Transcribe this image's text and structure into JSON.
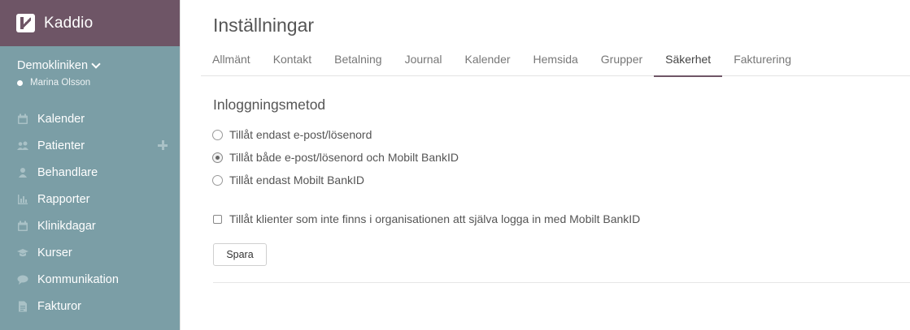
{
  "app": {
    "name": "Kaddio"
  },
  "clinic": {
    "name": "Demokliniken",
    "user": "Marina Olsson"
  },
  "sidebar": {
    "items": [
      {
        "label": "Kalender",
        "icon": "calendar-icon"
      },
      {
        "label": "Patienter",
        "icon": "users-icon",
        "has_add": true
      },
      {
        "label": "Behandlare",
        "icon": "user-icon"
      },
      {
        "label": "Rapporter",
        "icon": "bar-chart-icon"
      },
      {
        "label": "Klinikdagar",
        "icon": "calendar-icon"
      },
      {
        "label": "Kurser",
        "icon": "graduation-cap-icon"
      },
      {
        "label": "Kommunikation",
        "icon": "chat-bubble-icon"
      },
      {
        "label": "Fakturor",
        "icon": "document-icon"
      }
    ]
  },
  "page": {
    "title": "Inställningar"
  },
  "tabs": [
    {
      "label": "Allmänt"
    },
    {
      "label": "Kontakt"
    },
    {
      "label": "Betalning"
    },
    {
      "label": "Journal"
    },
    {
      "label": "Kalender"
    },
    {
      "label": "Hemsida"
    },
    {
      "label": "Grupper"
    },
    {
      "label": "Säkerhet",
      "active": true
    },
    {
      "label": "Fakturering"
    }
  ],
  "security": {
    "section_title": "Inloggningsmetod",
    "options": [
      {
        "label": "Tillåt endast e-post/lösenord",
        "checked": false
      },
      {
        "label": "Tillåt både e-post/lösenord och Mobilt BankID",
        "checked": true
      },
      {
        "label": "Tillåt endast Mobilt BankID",
        "checked": false
      }
    ],
    "allow_external_label": "Tillåt klienter som inte finns i organisationen att själva logga in med Mobilt BankID",
    "allow_external_checked": false,
    "save_label": "Spara"
  },
  "colors": {
    "brand": "#6e5566",
    "sidebar": "#7b9ea6",
    "icon": "#a9c1c6"
  }
}
